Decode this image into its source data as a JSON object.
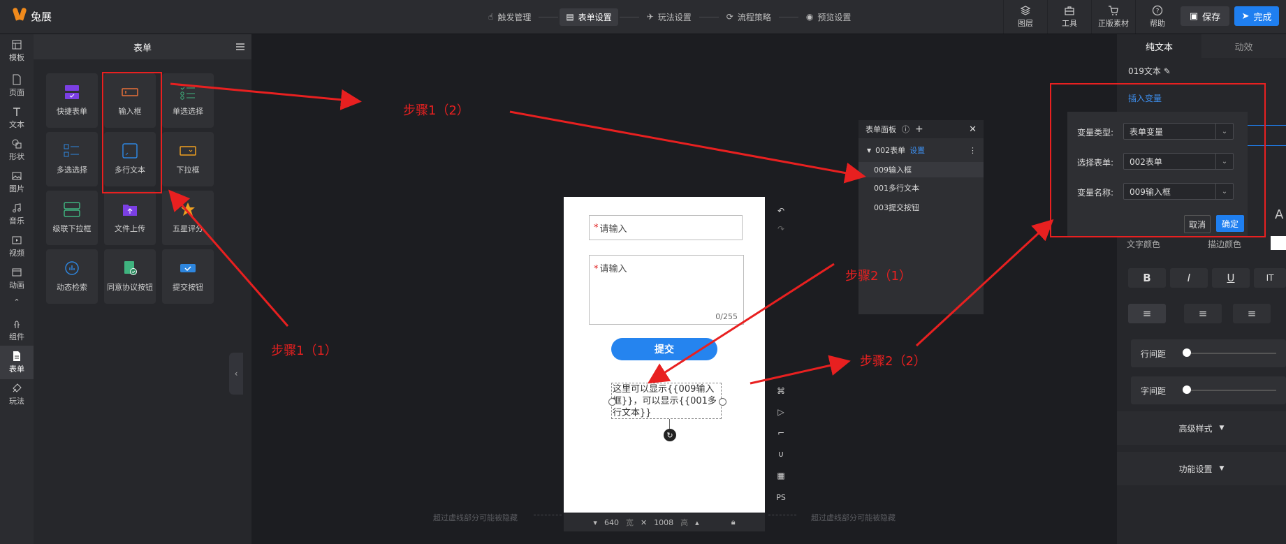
{
  "app": {
    "name": "兔展"
  },
  "steps": [
    {
      "label": "触发管理",
      "icon": "trigger-icon",
      "active": false
    },
    {
      "label": "表单设置",
      "icon": "form-icon",
      "active": true
    },
    {
      "label": "玩法设置",
      "icon": "rocket-icon",
      "active": false
    },
    {
      "label": "流程策略",
      "icon": "flow-icon",
      "active": false
    },
    {
      "label": "预览设置",
      "icon": "eye-icon",
      "active": false
    }
  ],
  "tools": [
    {
      "label": "图层",
      "icon": "layers-icon"
    },
    {
      "label": "工具",
      "icon": "toolbox-icon"
    },
    {
      "label": "正版素材",
      "icon": "cart-icon"
    },
    {
      "label": "帮助",
      "icon": "help-icon"
    }
  ],
  "actions": {
    "save": "保存",
    "done": "完成"
  },
  "rail": [
    {
      "label": "模板",
      "icon": "template-icon"
    },
    {
      "label": "页面",
      "icon": "page-icon"
    },
    {
      "label": "文本",
      "icon": "text-icon"
    },
    {
      "label": "形状",
      "icon": "shape-icon"
    },
    {
      "label": "图片",
      "icon": "image-icon"
    },
    {
      "label": "音乐",
      "icon": "music-icon"
    },
    {
      "label": "视频",
      "icon": "video-icon"
    },
    {
      "label": "动画",
      "icon": "animation-icon"
    },
    {
      "label": "组件",
      "icon": "component-icon"
    },
    {
      "label": "表单",
      "icon": "form-icon"
    },
    {
      "label": "玩法",
      "icon": "play-icon"
    }
  ],
  "panel": {
    "title": "表单",
    "tiles": [
      {
        "label": "快捷表单",
        "icon": "quick-form-icon",
        "color": "#7b3fe4"
      },
      {
        "label": "输入框",
        "icon": "input-icon",
        "color": "#e8703a"
      },
      {
        "label": "单选选择",
        "icon": "radio-icon",
        "color": "#3fb37f"
      },
      {
        "label": "多选选择",
        "icon": "checkbox-icon",
        "color": "#2e86de"
      },
      {
        "label": "多行文本",
        "icon": "textarea-icon",
        "color": "#2e86de"
      },
      {
        "label": "下拉框",
        "icon": "dropdown-icon",
        "color": "#f0a020"
      },
      {
        "label": "级联下拉框",
        "icon": "cascade-icon",
        "color": "#3fb37f"
      },
      {
        "label": "文件上传",
        "icon": "upload-icon",
        "color": "#7b3fe4"
      },
      {
        "label": "五星评分",
        "icon": "star-icon",
        "color": "#f0a020"
      },
      {
        "label": "动态检索",
        "icon": "search-chart-icon",
        "color": "#2e86de"
      },
      {
        "label": "同意协议按钮",
        "icon": "agree-icon",
        "color": "#3fb37f"
      },
      {
        "label": "提交按钮",
        "icon": "submit-icon",
        "color": "#2e86de"
      }
    ]
  },
  "canvas": {
    "input_placeholder": "请输入",
    "textarea_placeholder": "请输入",
    "textarea_counter": "0/255",
    "submit_label": "提交",
    "text_element": "这里可以显示{{009输入框}}，可以显示{{001多行文本}}",
    "width": "640",
    "width_unit": "宽",
    "height": "1008",
    "height_unit": "高",
    "hint_left": "超过虚线部分可能被隐藏",
    "hint_right": "超过虚线部分可能被隐藏",
    "side_tools": [
      "undo-icon",
      "redo-icon",
      "shortcut-icon",
      "play-icon",
      "paint-icon",
      "magnet-icon",
      "grid-icon"
    ],
    "ps_label": "PS"
  },
  "form_panel": {
    "title": "表单面板",
    "group": "002表单",
    "group_link": "设置",
    "items": [
      "009输入框",
      "001多行文本",
      "003提交按钮"
    ]
  },
  "right_panel": {
    "tabs": [
      "纯文本",
      "动效"
    ],
    "element_name": "019文本",
    "insert_variable": "插入变量",
    "clipped_labels": [
      "文字颜色",
      "描边颜色"
    ],
    "format_buttons": [
      "B",
      "I",
      "U",
      "IT"
    ],
    "align_buttons": [
      "align-left-icon",
      "align-center-icon",
      "align-right-icon"
    ],
    "line_spacing": "行间距",
    "letter_spacing": "字间距",
    "advanced": "高级样式",
    "functions": "功能设置"
  },
  "variable_popup": {
    "rows": [
      {
        "label": "变量类型:",
        "value": "表单变量"
      },
      {
        "label": "选择表单:",
        "value": "002表单"
      },
      {
        "label": "变量名称:",
        "value": "009输入框"
      }
    ],
    "cancel": "取消",
    "confirm": "确定"
  },
  "annotations": {
    "step1_1": "步骤1（1）",
    "step1_2": "步骤1（2）",
    "step2_1": "步骤2（1）",
    "step2_2": "步骤2（2）",
    "color": "#e82020"
  }
}
